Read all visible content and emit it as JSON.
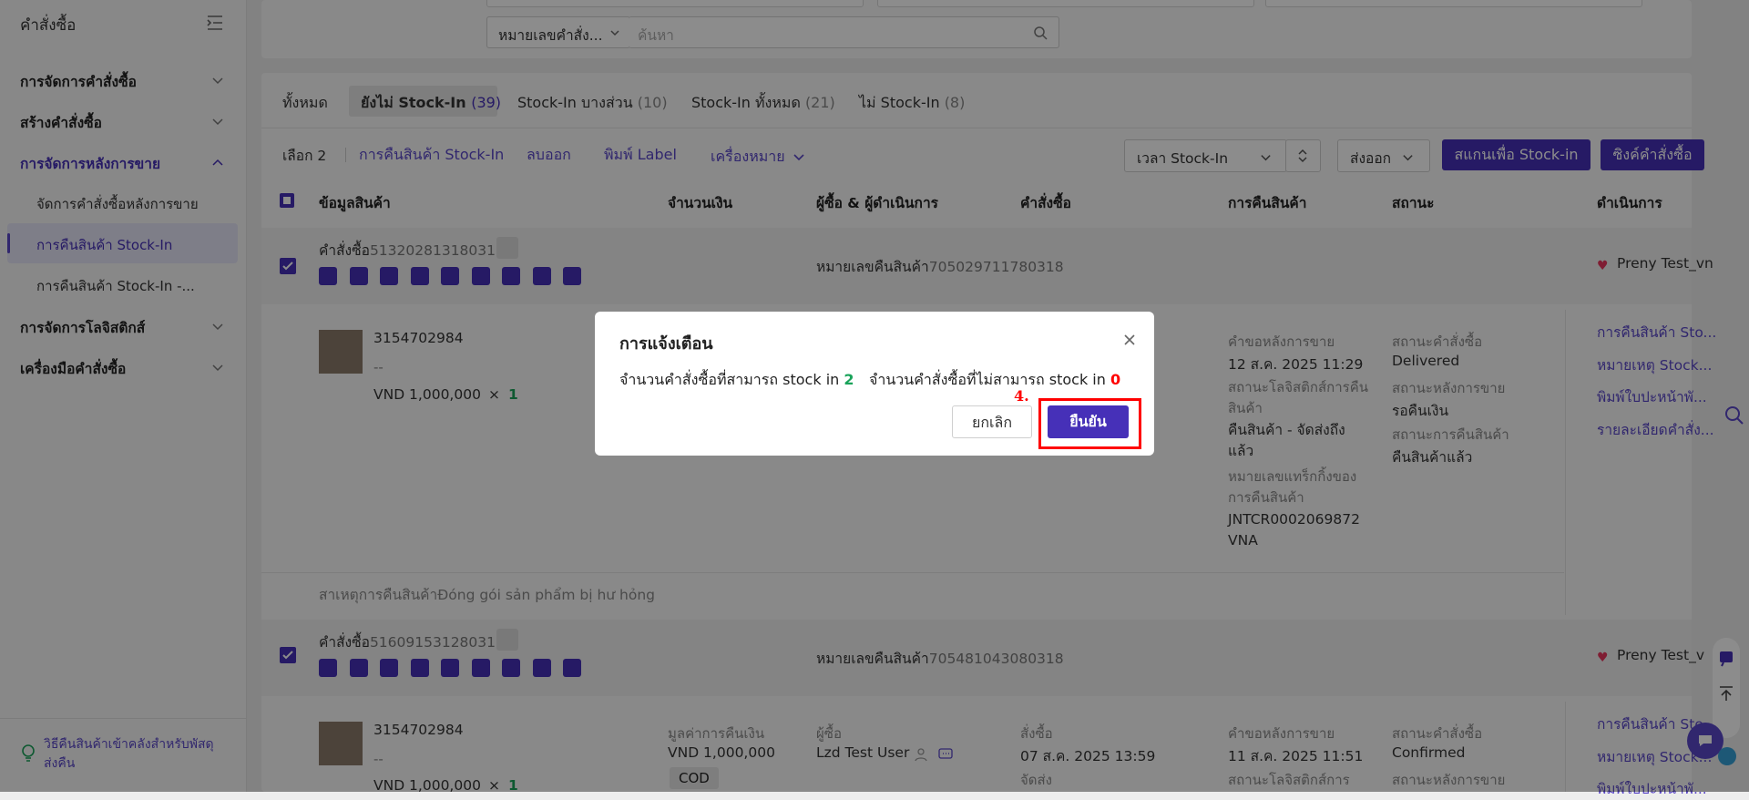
{
  "sidebar": {
    "title": "คำสั่งซื้อ",
    "sections": [
      {
        "label": "การจัดการคำสั่งซื้อ"
      },
      {
        "label": "สร้างคำสั่งซื้อ"
      },
      {
        "label": "การจัดการหลังการขาย"
      },
      {
        "label": "การจัดการโลจิสติกส์"
      },
      {
        "label": "เครื่องมือคำสั่งซื้อ"
      }
    ],
    "sub_items": [
      {
        "label": "จัดการคำสั่งซื้อหลังการขาย"
      },
      {
        "label": "การคืนสินค้า Stock-In"
      },
      {
        "label": "การคืนสินค้า Stock-In -..."
      }
    ],
    "footer_text": "วิธีคืนสินค้าเข้าคลังสำหรับพัสดุส่งคืน"
  },
  "search": {
    "type_select": "หมายเลขคำสั่ง...",
    "placeholder": "ค้นหา"
  },
  "tabs": [
    {
      "label": "ทั้งหมด",
      "count": ""
    },
    {
      "label": "ยังไม่ Stock-In",
      "count": "(39)"
    },
    {
      "label": "Stock-In บางส่วน",
      "count": "(10)"
    },
    {
      "label": "Stock-In ทั้งหมด",
      "count": "(21)"
    },
    {
      "label": "ไม่ Stock-In",
      "count": "(8)"
    }
  ],
  "toolbar": {
    "selected": "เลือก 2",
    "return_stockin": "การคืนสินค้า Stock-In",
    "delete": "ลบออก",
    "print_label": "พิมพ์ Label",
    "tags": "เครื่องหมาย",
    "time_select": "เวลา Stock-In",
    "export": "ส่งออก",
    "scan_button": "สแกนเพื่อ Stock-in",
    "sync_button": "ซิงค์คำสั่งซื้อ"
  },
  "table": {
    "headers": [
      "ข้อมูลสินค้า",
      "จำนวนเงิน",
      "ผู้ซื้อ & ผู้ดำเนินการ",
      "คำสั่งซื้อ",
      "การคืนสินค้า",
      "สถานะ",
      "ดำเนินการ"
    ],
    "orders": [
      {
        "order_label": "คำสั่งซื้อ",
        "order_no": "513202813180318",
        "return_label": "หมายเลขคืนสินค้า",
        "return_no": "705029711780318",
        "shop": "Preny Test_vn",
        "sku": "3154702984",
        "variant": "--",
        "price": "VND 1,000,000",
        "qty_sep": "×",
        "qty": "1",
        "aftersale_label": "คำขอหลังการขาย",
        "aftersale_time": "12 ส.ค. 2025 11:29",
        "logistics_label": "สถานะโลจิสติกส์การคืนสินค้า",
        "logistics_value": "คืนสินค้า - จัดส่งถึงแล้ว",
        "tracking_label": "หมายเลขแทร็กกิ้งของการคืนสินค้า",
        "tracking_value": "JNTCR0002069872VNA",
        "order_status_label": "สถานะคำสั่งซื้อ",
        "order_status": "Delivered",
        "aftersale_status_label": "สถานะหลังการขาย",
        "aftersale_status": "รอคืนเงิน",
        "return_status_label": "สถานะการคืนสินค้า",
        "return_status": "คืนสินค้าแล้ว",
        "actions": [
          "การคืนสินค้า Sto...",
          "หมายเหตุ Stock...",
          "พิมพ์ใบปะหน้าพั...",
          "รายละเอียดคำสั่ง..."
        ],
        "reason": "สาเหตุการคืนสินค้าĐóng gói sản phẩm bị hư hỏng"
      },
      {
        "order_label": "คำสั่งซื้อ",
        "order_no": "516091531280318",
        "return_label": "หมายเลขคืนสินค้า",
        "return_no": "705481043080318",
        "shop": "Preny Test_v",
        "sku": "3154702984",
        "variant": "--",
        "price": "VND 1,000,000",
        "qty_sep": "×",
        "qty": "1",
        "refund_label": "มูลค่าการคืนเงิน",
        "refund_value": "VND 1,000,000",
        "payment": "COD",
        "buyer_label": "ผู้ซื้อ",
        "buyer": "Lzd Test User",
        "ordered_label": "สั่งซื้อ",
        "ordered_time": "07 ส.ค. 2025 13:59",
        "shipped_label": "จัดส่ง",
        "aftersale_label": "คำขอหลังการขาย",
        "aftersale_time": "11 ส.ค. 2025 11:51",
        "logistics_label": "สถานะโลจิสติกส์การ",
        "order_status_label": "สถานะคำสั่งซื้อ",
        "order_status": "Confirmed",
        "aftersale_status_label": "สถานะหลังการขาย",
        "actions": [
          "การคืนสินค้า Sto...",
          "หมายเหตุ Stock...",
          "พิมพ์ใบปะหน้าพั..."
        ]
      }
    ]
  },
  "modal": {
    "title": "การแจ้งเตือน",
    "can_label": "จำนวนคำสั่งซื้อที่สามารถ stock in",
    "can_count": "2",
    "cannot_label": "จำนวนคำสั่งซื้อที่ไม่สามารถ stock in",
    "cannot_count": "0",
    "cancel": "ยกเลิก",
    "confirm": "ยืนยัน",
    "step": "4."
  },
  "colors": {
    "accent": "#4630b8",
    "success": "#1aa35a",
    "danger": "#ff0000",
    "heart": "#e8355d"
  }
}
